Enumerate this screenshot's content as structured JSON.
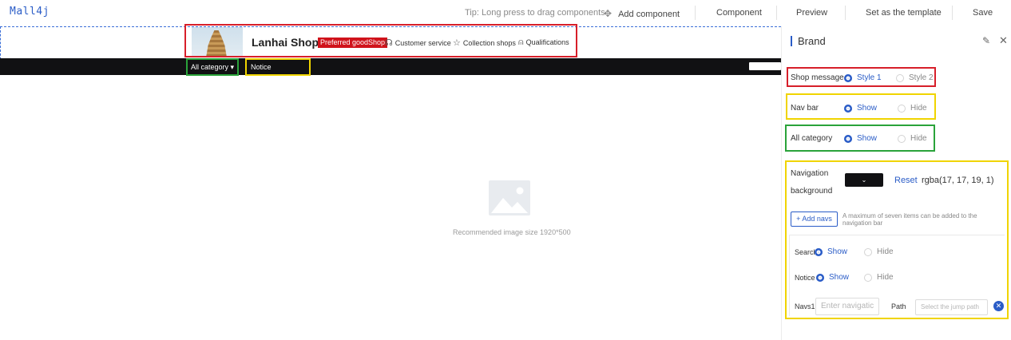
{
  "app": {
    "logo": "Mall4j"
  },
  "toolbar": {
    "tip": "Tip: Long press to drag components",
    "add_component": "Add component",
    "component": "Component",
    "preview": "Preview",
    "set_template": "Set as the template",
    "save": "Save"
  },
  "canvas": {
    "shop_name": "Lanhai Shop",
    "preferred_badge": "Preferred goodShop",
    "links": {
      "customer_service": "Customer service",
      "collection_shops": "Collection shops",
      "qualifications": "Qualifications"
    },
    "nav": {
      "all_category": "All category",
      "notice": "Notice"
    },
    "recommend_text": "Recommended image size 1920*500"
  },
  "panel": {
    "title": "Brand",
    "shop_message": {
      "label": "Shop message",
      "opt1": "Style 1",
      "opt2": "Style 2",
      "selected": "Style 1"
    },
    "nav_bar": {
      "label": "Nav bar",
      "opt1": "Show",
      "opt2": "Hide",
      "selected": "Show"
    },
    "all_category": {
      "label": "All category",
      "opt1": "Show",
      "opt2": "Hide",
      "selected": "Show"
    },
    "nav_background": {
      "label_line1": "Navigation",
      "label_line2": "background",
      "reset": "Reset",
      "value": "rgba(17, 17, 19, 1)"
    },
    "add_navs": "+ Add navs",
    "add_navs_hint": "A maximum of seven items can be added to the navigation bar",
    "search": {
      "label": "Search",
      "opt1": "Show",
      "opt2": "Hide",
      "selected": "Show"
    },
    "notice": {
      "label": "Notice",
      "opt1": "Show",
      "opt2": "Hide",
      "selected": "Show"
    },
    "navs1": {
      "label": "Navs1",
      "name_placeholder": "Enter navigatic",
      "path_label": "Path",
      "path_placeholder": "Select the jump path"
    }
  },
  "colors": {
    "accent": "#2a5cc7",
    "navbar_bg": "#111113",
    "badge_red": "#d0131b",
    "highlight_red": "#d71f2a",
    "highlight_yellow": "#f0d400",
    "highlight_green": "#2aa33a"
  },
  "icons": {
    "add_component": "move-arrows-icon",
    "customer_service": "headset-icon",
    "collection_shops": "star-icon",
    "qualifications": "ribbon-icon",
    "edit": "edit-icon",
    "close": "close-icon",
    "image_placeholder": "image-icon",
    "remove": "close-circle-icon"
  }
}
